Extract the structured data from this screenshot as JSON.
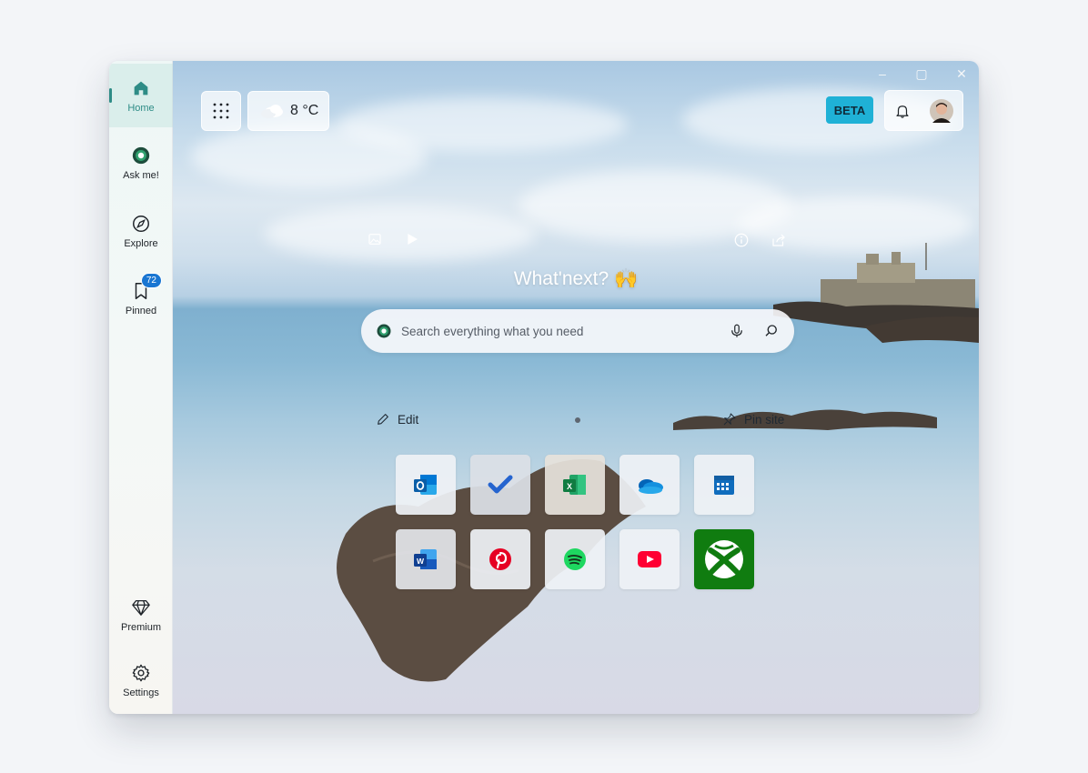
{
  "sidebar": {
    "items": [
      {
        "label": "Home",
        "icon": "home-icon",
        "active": true
      },
      {
        "label": "Ask me!",
        "icon": "ask-icon"
      },
      {
        "label": "Explore",
        "icon": "compass-icon"
      },
      {
        "label": "Pinned",
        "icon": "bookmark-icon",
        "badge": "72"
      },
      {
        "label": "Premium",
        "icon": "diamond-icon"
      },
      {
        "label": "Settings",
        "icon": "gear-icon"
      }
    ]
  },
  "header": {
    "weather": "8 °C",
    "beta": "BETA"
  },
  "hero": {
    "headline": "What'next? 🙌",
    "search_placeholder": "Search everything what you need"
  },
  "quicklinks": {
    "edit_label": "Edit",
    "pin_label": "Pin site"
  },
  "tiles": [
    {
      "name": "outlook",
      "icon": "outlook-icon"
    },
    {
      "name": "todo",
      "icon": "todo-icon"
    },
    {
      "name": "excel",
      "icon": "excel-icon"
    },
    {
      "name": "onedrive",
      "icon": "onedrive-icon"
    },
    {
      "name": "calendar",
      "icon": "calendar-icon"
    },
    {
      "name": "word",
      "icon": "word-icon"
    },
    {
      "name": "pinterest",
      "icon": "pinterest-icon"
    },
    {
      "name": "spotify",
      "icon": "spotify-icon"
    },
    {
      "name": "youtube",
      "icon": "youtube-icon"
    },
    {
      "name": "xbox",
      "icon": "xbox-icon"
    }
  ],
  "colors": {
    "accent": "#2e8c86",
    "beta": "#1fb1d6",
    "badge": "#1976d2"
  }
}
